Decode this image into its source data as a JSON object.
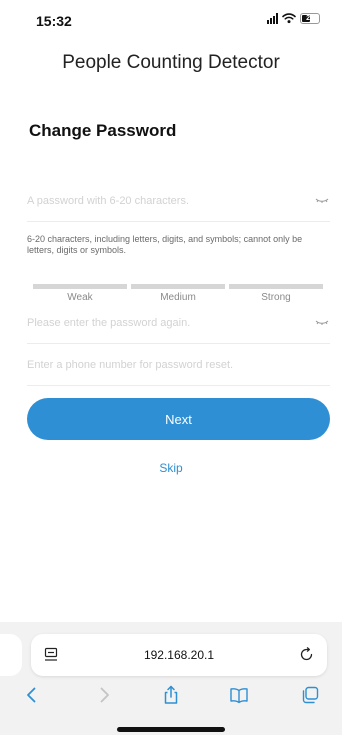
{
  "status_bar": {
    "time": "15:32",
    "battery": "23"
  },
  "app_title": "People Counting Detector",
  "page_title": "Change Password",
  "form": {
    "password_placeholder": "A password with 6-20 characters.",
    "hint": "6-20 characters, including letters, digits, and symbols; cannot only be letters, digits or symbols.",
    "strength_labels": [
      "Weak",
      "Medium",
      "Strong"
    ],
    "confirm_placeholder": "Please enter the password again.",
    "phone_placeholder": "Enter a phone number for password reset."
  },
  "next_label": "Next",
  "skip_label": "Skip",
  "browser": {
    "url": "192.168.20.1"
  },
  "colors": {
    "accent": "#2e8fd4",
    "strength_bar": "#d6d6d6"
  },
  "icons": [
    "cellular-icon",
    "wifi-icon",
    "battery-icon",
    "eye-closed-icon",
    "page-menu-icon",
    "reload-icon",
    "back-icon",
    "forward-icon",
    "share-icon",
    "bookmarks-icon",
    "tabs-icon"
  ]
}
